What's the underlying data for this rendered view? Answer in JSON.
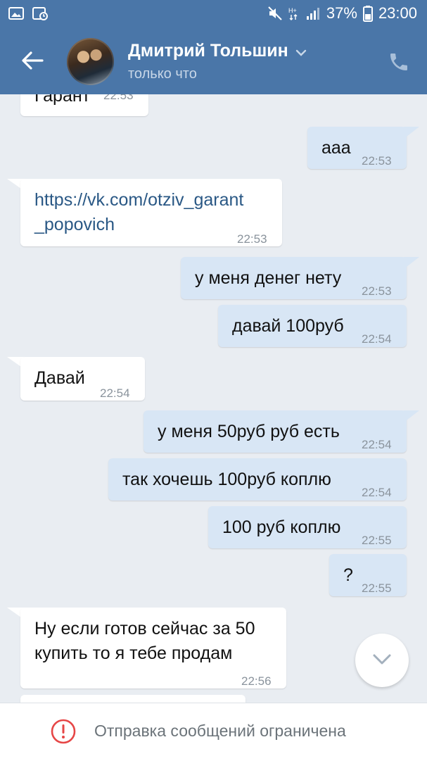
{
  "status_bar": {
    "battery": "37%",
    "time": "23:00"
  },
  "header": {
    "contact_name": "Дмитрий Тольшин",
    "status": "только что"
  },
  "messages": [
    {
      "dir": "in",
      "text": "Гарант",
      "time": "22:53"
    },
    {
      "dir": "out",
      "text": "ааа",
      "time": "22:53"
    },
    {
      "dir": "in",
      "text_line1": "https://vk.com/otziv_garant",
      "text_line2": "_popovich",
      "time": "22:53"
    },
    {
      "dir": "out",
      "text": "у меня денег нету",
      "time": "22:53"
    },
    {
      "dir": "out",
      "text": "давай 100руб",
      "time": "22:54"
    },
    {
      "dir": "in",
      "text": "Давай",
      "time": "22:54"
    },
    {
      "dir": "out",
      "text": "у меня 50руб руб есть",
      "time": "22:54"
    },
    {
      "dir": "out",
      "text": "так хочешь 100руб коплю",
      "time": "22:54"
    },
    {
      "dir": "out",
      "text": "100 руб коплю",
      "time": "22:55"
    },
    {
      "dir": "out",
      "text": "?",
      "time": "22:55"
    },
    {
      "dir": "in",
      "text_line1": "Ну если готов сейчас за 50",
      "text_line2": "купить то я тебе продам",
      "time": "22:56"
    }
  ],
  "bottom_bar": {
    "notice": "Отправка сообщений ограничена"
  },
  "icons": {
    "back": "arrow-left-icon",
    "call": "phone-icon",
    "scroll_down": "chevron-down-icon",
    "warning": "exclamation-circle-icon"
  },
  "colors": {
    "header": "#4a76a8",
    "incoming": "#ffffff",
    "outgoing": "#d8e6f5",
    "link": "#2a5885",
    "warning": "#e64646"
  }
}
